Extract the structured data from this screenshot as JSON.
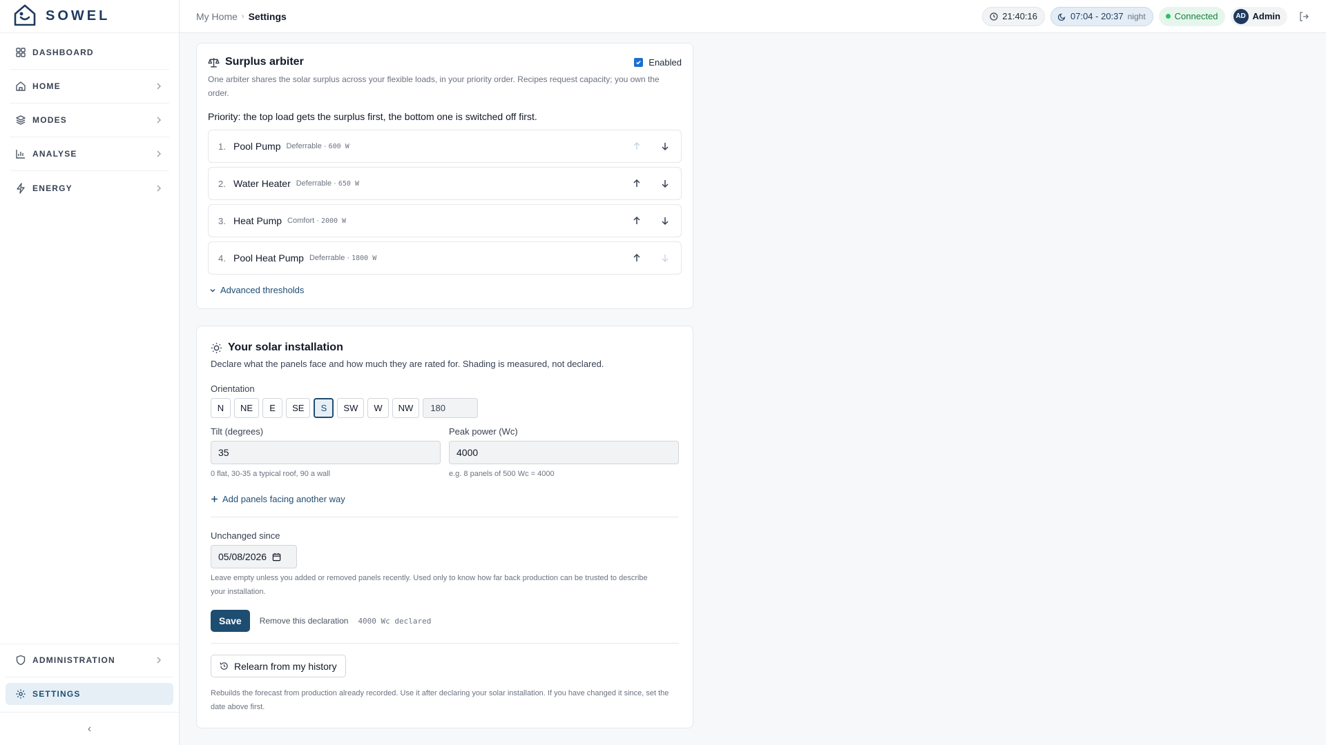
{
  "app": {
    "name": "SOWEL"
  },
  "sidebar": {
    "items": [
      {
        "label": "DASHBOARD",
        "icon": "grid-icon"
      },
      {
        "label": "HOME",
        "icon": "house-icon"
      },
      {
        "label": "MODES",
        "icon": "layers-icon"
      },
      {
        "label": "ANALYSE",
        "icon": "bar-chart-icon"
      },
      {
        "label": "ENERGY",
        "icon": "bolt-icon"
      }
    ],
    "bottom": [
      {
        "label": "ADMINISTRATION",
        "icon": "shield-icon"
      },
      {
        "label": "SETTINGS",
        "icon": "gear-icon"
      }
    ],
    "collapse_glyph": "‹"
  },
  "header": {
    "breadcrumb_home": "My Home",
    "breadcrumb_sep": "›",
    "breadcrumb_current": "Settings",
    "clock": "21:40:16",
    "sun_times": "07:04 - 20:37",
    "sun_phase": "night",
    "connection": "Connected",
    "user_initials": "AD",
    "user_name": "Admin"
  },
  "arbiter": {
    "title": "Surplus arbiter",
    "enabled_label": "Enabled",
    "description": "One arbiter shares the solar surplus across your flexible loads, in your priority order. Recipes request capacity; you own the order.",
    "priority_text": "Priority: the top load gets the surplus first, the bottom one is switched off first.",
    "loads": [
      {
        "num": "1.",
        "name": "Pool Pump",
        "kind": "Deferrable ·",
        "power": "600 W"
      },
      {
        "num": "2.",
        "name": "Water Heater",
        "kind": "Deferrable ·",
        "power": "650 W"
      },
      {
        "num": "3.",
        "name": "Heat Pump",
        "kind": "Comfort ·",
        "power": "2000 W"
      },
      {
        "num": "4.",
        "name": "Pool Heat Pump",
        "kind": "Deferrable ·",
        "power": "1800 W"
      }
    ],
    "advanced_label": "Advanced thresholds"
  },
  "solar": {
    "title": "Your solar installation",
    "description": "Declare what the panels face and how much they are rated for. Shading is measured, not declared.",
    "orientation_label": "Orientation",
    "orientations": [
      "N",
      "NE",
      "E",
      "SE",
      "S",
      "SW",
      "W",
      "NW"
    ],
    "selected_orientation": "S",
    "azimuth": "180",
    "tilt_label": "Tilt (degrees)",
    "tilt_value": "35",
    "tilt_hint": "0 flat, 30-35 a typical roof, 90 a wall",
    "peak_label": "Peak power (Wc)",
    "peak_value": "4000",
    "peak_hint": "e.g. 8 panels of 500 Wc = 4000",
    "add_panels_label": "Add panels facing another way",
    "unchanged_label": "Unchanged since",
    "unchanged_value": "05/08/2026",
    "unchanged_hint": "Leave empty unless you added or removed panels recently. Used only to know how far back production can be trusted to describe your installation.",
    "save_label": "Save",
    "remove_label": "Remove this declaration",
    "declared_text": "4000 Wc declared",
    "relearn_label": "Relearn from my history",
    "relearn_hint": "Rebuilds the forecast from production already recorded. Use it after declaring your solar installation. If you have changed it since, set the date above first."
  },
  "colors": {
    "brand": "#1e3a5f",
    "accent": "#1e4d72",
    "success": "#15803d"
  }
}
